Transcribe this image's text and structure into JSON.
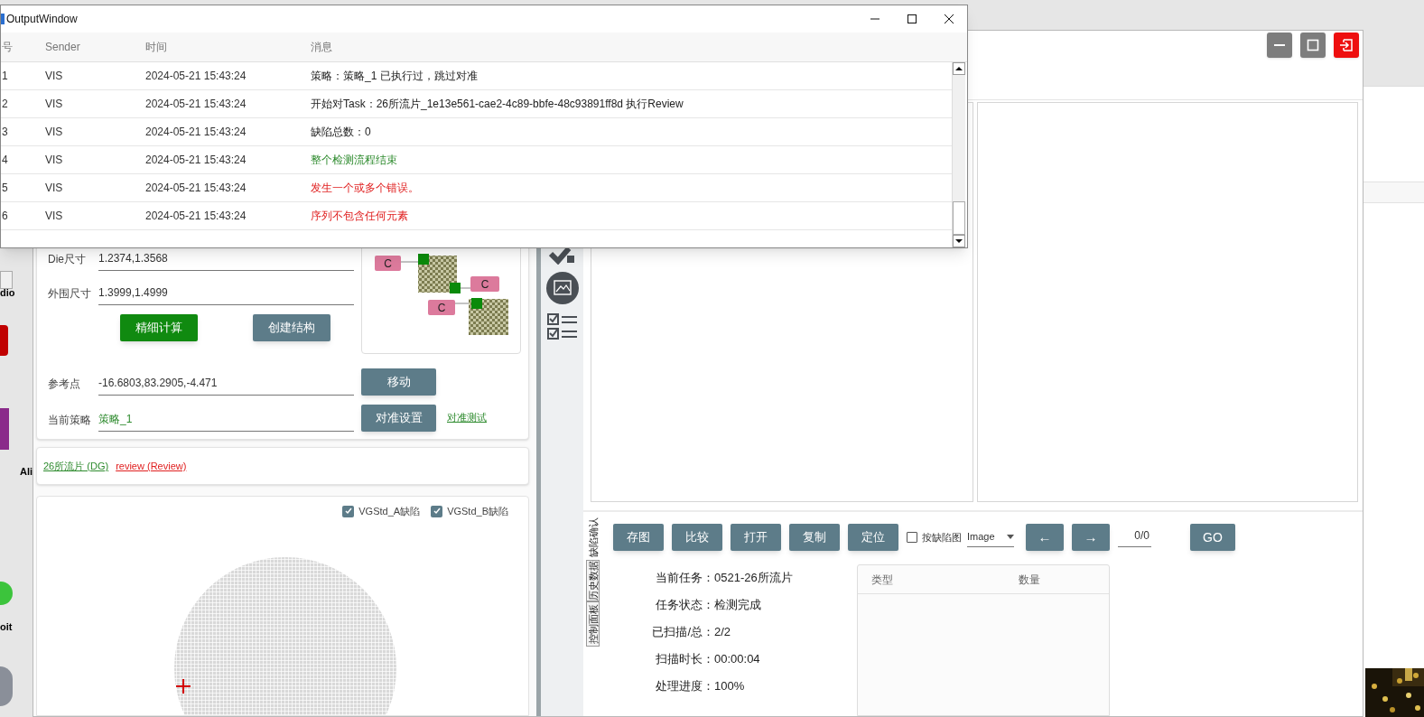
{
  "desktop_icons": [
    {
      "label": "dio"
    },
    {
      "label": "Ali"
    },
    {
      "label": "oit"
    }
  ],
  "output_window": {
    "title": "OutputWindow",
    "columns": [
      "号",
      "Sender",
      "时间",
      "消息"
    ],
    "rows": [
      {
        "no": "1",
        "sender": "VIS",
        "time": "2024-05-21 15:43:24",
        "message": "策略：策略_1 已执行过，跳过对准",
        "kind": "info"
      },
      {
        "no": "2",
        "sender": "VIS",
        "time": "2024-05-21 15:43:24",
        "message": "开始对Task：26所流片_1e13e561-cae2-4c89-bbfe-48c93891ff8d 执行Review",
        "kind": "info"
      },
      {
        "no": "3",
        "sender": "VIS",
        "time": "2024-05-21 15:43:24",
        "message": "缺陷总数：0",
        "kind": "info"
      },
      {
        "no": "4",
        "sender": "VIS",
        "time": "2024-05-21 15:43:24",
        "message": "整个检测流程结束",
        "kind": "success"
      },
      {
        "no": "5",
        "sender": "VIS",
        "time": "2024-05-21 15:43:24",
        "message": "发生一个或多个错误。",
        "kind": "error"
      },
      {
        "no": "6",
        "sender": "VIS",
        "time": "2024-05-21 15:43:24",
        "message": "序列不包含任何元素",
        "kind": "error"
      }
    ]
  },
  "left_panel": {
    "fields": [
      {
        "label": "Die尺寸",
        "value": "1.2374,1.3568"
      },
      {
        "label": "外围尺寸",
        "value": "1.3999,1.4999"
      }
    ],
    "calc_buttons": [
      {
        "label": "精细计算",
        "kind": "primary"
      },
      {
        "label": "创建结构",
        "kind": "secondary"
      }
    ],
    "diagram_labels": [
      "C",
      "C",
      "C"
    ],
    "reference": {
      "label": "参考点",
      "value": "-16.6803,83.2905,-4.471",
      "button": "移动"
    },
    "strategy": {
      "label": "当前策略",
      "value": "策略_1",
      "button": "对准设置",
      "link": "对准测试"
    },
    "task_links": [
      {
        "text": "26所流片 (DG)",
        "kind": "success"
      },
      {
        "text": "review (Review)",
        "kind": "error"
      }
    ],
    "layers": [
      {
        "label": "VGStd_A缺陷",
        "checked": true
      },
      {
        "label": "VGStd_B缺陷",
        "checked": true
      }
    ]
  },
  "side_tabs": [
    {
      "label": "缺陷确认",
      "selected": true
    },
    {
      "label": "历史数据",
      "selected": false
    },
    {
      "label": "控制面板",
      "selected": false
    }
  ],
  "toolbar": {
    "buttons": [
      "存图",
      "比较",
      "打开",
      "复制",
      "定位"
    ],
    "defect_checkbox": {
      "label": "按缺陷图",
      "checked": false
    },
    "image_select": "Image",
    "prev": "←",
    "next": "→",
    "page": "0/0",
    "go": "GO"
  },
  "task_info": [
    {
      "label": "当前任务：",
      "value": "0521-26所流片"
    },
    {
      "label": "任务状态：",
      "value": "检测完成"
    },
    {
      "label": "已扫描/总：",
      "value": "2/2"
    },
    {
      "label": "扫描时长：",
      "value": "00:00:04"
    },
    {
      "label": "处理进度：",
      "value": "100%"
    }
  ],
  "defect_table": {
    "columns": [
      "类型",
      "数量"
    ]
  }
}
